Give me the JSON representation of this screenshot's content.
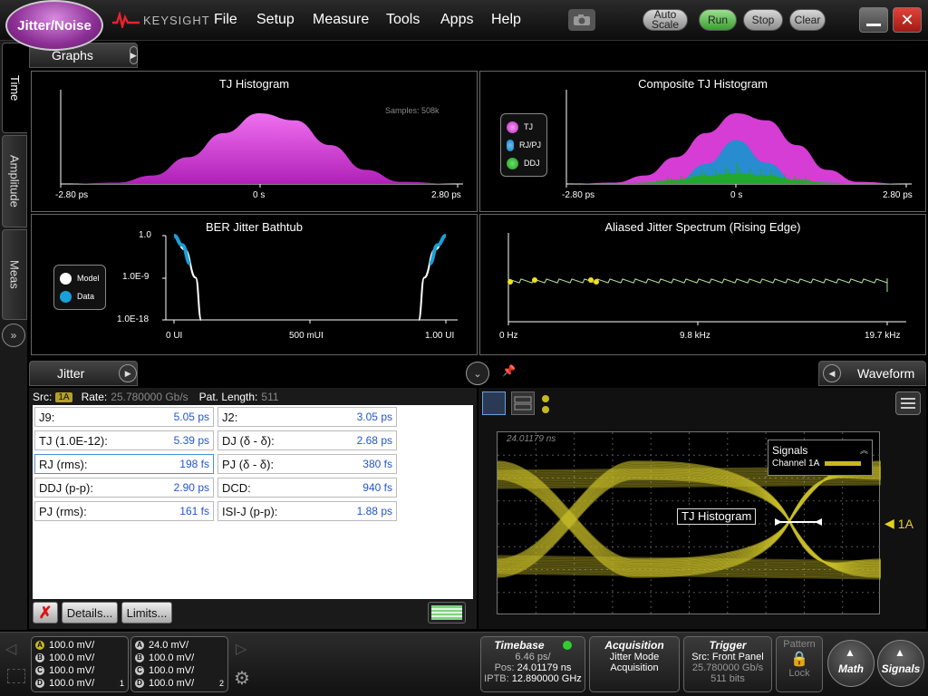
{
  "app": {
    "badge": "Jitter/Noise",
    "brand": "KEYSIGHT"
  },
  "menu": [
    "File",
    "Setup",
    "Measure",
    "Tools",
    "Apps",
    "Help"
  ],
  "toolbar": {
    "autoscale": "Auto Scale",
    "run": "Run",
    "stop": "Stop",
    "clear": "Clear"
  },
  "sidetabs": [
    "Time",
    "Amplitude",
    "Meas"
  ],
  "graphs_panel": {
    "title": "Graphs"
  },
  "charts": {
    "tj": {
      "title": "TJ Histogram",
      "samples": "Samples: 508k",
      "ticks": [
        "-2.80 ps",
        "0 s",
        "2.80 ps"
      ]
    },
    "composite": {
      "title": "Composite TJ Histogram",
      "ticks": [
        "-2.80 ps",
        "0 s",
        "2.80 ps"
      ],
      "legend": [
        "TJ",
        "RJ/PJ",
        "DDJ"
      ]
    },
    "bathtub": {
      "title": "BER Jitter Bathtub",
      "yticks": [
        "1.0",
        "1.0E-9",
        "1.0E-18"
      ],
      "xticks": [
        "0 UI",
        "500 mUI",
        "1.00 UI"
      ],
      "legend": [
        "Model",
        "Data"
      ]
    },
    "spectrum": {
      "title": "Aliased Jitter Spectrum (Rising Edge)",
      "xticks": [
        "0 Hz",
        "9.8 kHz",
        "19.7 kHz"
      ]
    }
  },
  "chart_data": [
    {
      "type": "area",
      "title": "TJ Histogram",
      "x_ticks": [
        "-2.80 ps",
        "0 s",
        "2.80 ps"
      ],
      "xlim": [
        -2.8,
        2.8
      ],
      "x": [
        -2.8,
        -2.0,
        -1.5,
        -1.0,
        -0.5,
        0.0,
        0.5,
        1.0,
        1.5,
        2.0,
        2.8
      ],
      "y": [
        0,
        0.02,
        0.12,
        0.38,
        0.72,
        1.0,
        0.9,
        0.55,
        0.2,
        0.03,
        0
      ],
      "annotation": "Samples: 508k"
    },
    {
      "type": "area",
      "title": "Composite TJ Histogram",
      "x_ticks": [
        "-2.80 ps",
        "0 s",
        "2.80 ps"
      ],
      "xlim": [
        -2.8,
        2.8
      ],
      "x": [
        -2.8,
        -2.0,
        -1.5,
        -1.0,
        -0.5,
        0.0,
        0.5,
        1.0,
        1.5,
        2.0,
        2.8
      ],
      "series": [
        {
          "name": "TJ",
          "color": "#e040e0",
          "values": [
            0,
            0.02,
            0.12,
            0.38,
            0.72,
            1.0,
            0.9,
            0.55,
            0.2,
            0.03,
            0
          ]
        },
        {
          "name": "RJ/PJ",
          "color": "#1e90d0",
          "values": [
            0,
            0,
            0,
            0.02,
            0.28,
            0.62,
            0.3,
            0.02,
            0,
            0,
            0
          ]
        },
        {
          "name": "DDJ",
          "color": "#22aa22",
          "values": [
            0,
            0,
            0.02,
            0.06,
            0.12,
            0.15,
            0.12,
            0.06,
            0.02,
            0,
            0
          ]
        }
      ]
    },
    {
      "type": "line",
      "title": "BER Jitter Bathtub",
      "y_ticks": [
        "1.0",
        "1.0E-9",
        "1.0E-18"
      ],
      "x_ticks": [
        "0 UI",
        "500 mUI",
        "1.00 UI"
      ],
      "xlim": [
        0,
        1
      ],
      "ylim": [
        -18,
        0
      ],
      "series": [
        {
          "name": "Model",
          "color": "#ffffff",
          "x": [
            0.0,
            0.04,
            0.08,
            0.1
          ],
          "y": [
            0,
            -3,
            -9,
            -18
          ]
        },
        {
          "name": "Model",
          "color": "#ffffff",
          "x": [
            0.9,
            0.92,
            0.96,
            1.0
          ],
          "y": [
            -18,
            -9,
            -3,
            0
          ]
        },
        {
          "name": "Data",
          "color": "#1aa0d8",
          "x": [
            0.0,
            0.03,
            0.06
          ],
          "y": [
            0,
            -2,
            -6
          ]
        },
        {
          "name": "Data",
          "color": "#1aa0d8",
          "x": [
            0.94,
            0.97,
            1.0
          ],
          "y": [
            -6,
            -2,
            0
          ]
        }
      ]
    },
    {
      "type": "line",
      "title": "Aliased Jitter Spectrum (Rising Edge)",
      "x_ticks": [
        "0 Hz",
        "9.8 kHz",
        "19.7 kHz"
      ],
      "xlim": [
        0,
        19.7
      ],
      "series": [
        {
          "name": "",
          "color": "#b8e8a0",
          "x": [
            0,
            0.9,
            2.5,
            10,
            19.7
          ],
          "y": [
            1,
            0.9,
            0.8,
            0.2,
            0.1
          ]
        }
      ]
    }
  ],
  "jitter_panel": {
    "title": "Jitter",
    "src_label": "Src:",
    "src_badge": "1A",
    "rate": "Rate:",
    "rate_val": "25.780000 Gb/s",
    "patlen": "Pat. Length:",
    "patlen_val": "511",
    "measurements": [
      {
        "label": "J9:",
        "value": "5.05 ps"
      },
      {
        "label": "J2:",
        "value": "3.05 ps"
      },
      {
        "label": "TJ (1.0E-12):",
        "value": "5.39 ps"
      },
      {
        "label": "DJ (δ - δ):",
        "value": "2.68 ps"
      },
      {
        "label": "RJ (rms):",
        "value": "198 fs"
      },
      {
        "label": "PJ (δ - δ):",
        "value": "380 fs"
      },
      {
        "label": "DDJ (p-p):",
        "value": "2.90 ps"
      },
      {
        "label": "DCD:",
        "value": "940 fs"
      },
      {
        "label": "PJ (rms):",
        "value": "161 fs"
      },
      {
        "label": "ISI-J (p-p):",
        "value": "1.88 ps"
      }
    ],
    "details_btn": "Details...",
    "limits_btn": "Limits..."
  },
  "waveform_panel": {
    "title": "Waveform",
    "time_label": "24.01179 ns",
    "signals_title": "Signals",
    "signal_name": "Channel 1A",
    "marker_label": "TJ Histogram",
    "channel_marker": "1A"
  },
  "bottom": {
    "ch1": [
      {
        "l": "A",
        "v": "100.0 mV/"
      },
      {
        "l": "B",
        "v": "100.0 mV/"
      },
      {
        "l": "C",
        "v": "100.0 mV/"
      },
      {
        "l": "D",
        "v": "100.0 mV/"
      }
    ],
    "ch1_num": "1",
    "ch2": [
      {
        "l": "A",
        "v": "24.0 mV/"
      },
      {
        "l": "B",
        "v": "100.0 mV/"
      },
      {
        "l": "C",
        "v": "100.0 mV/"
      },
      {
        "l": "D",
        "v": "100.0 mV/"
      }
    ],
    "ch2_num": "2",
    "timebase": {
      "title": "Timebase",
      "scale": "6.46 ps/",
      "pos": "Pos:",
      "pos_val": "24.01179 ns",
      "iptb": "IPTB:",
      "iptb_val": "12.890000 GHz"
    },
    "acquisition": {
      "title": "Acquisition",
      "line1": "Jitter Mode",
      "line2": "Acquisition"
    },
    "trigger": {
      "title": "Trigger",
      "src": "Src: Front Panel",
      "rate": "25.780000 Gb/s",
      "bits": "511 bits"
    },
    "pattern": {
      "title": "Pattern",
      "lock": "Lock"
    },
    "math": "Math",
    "signals": "Signals"
  }
}
